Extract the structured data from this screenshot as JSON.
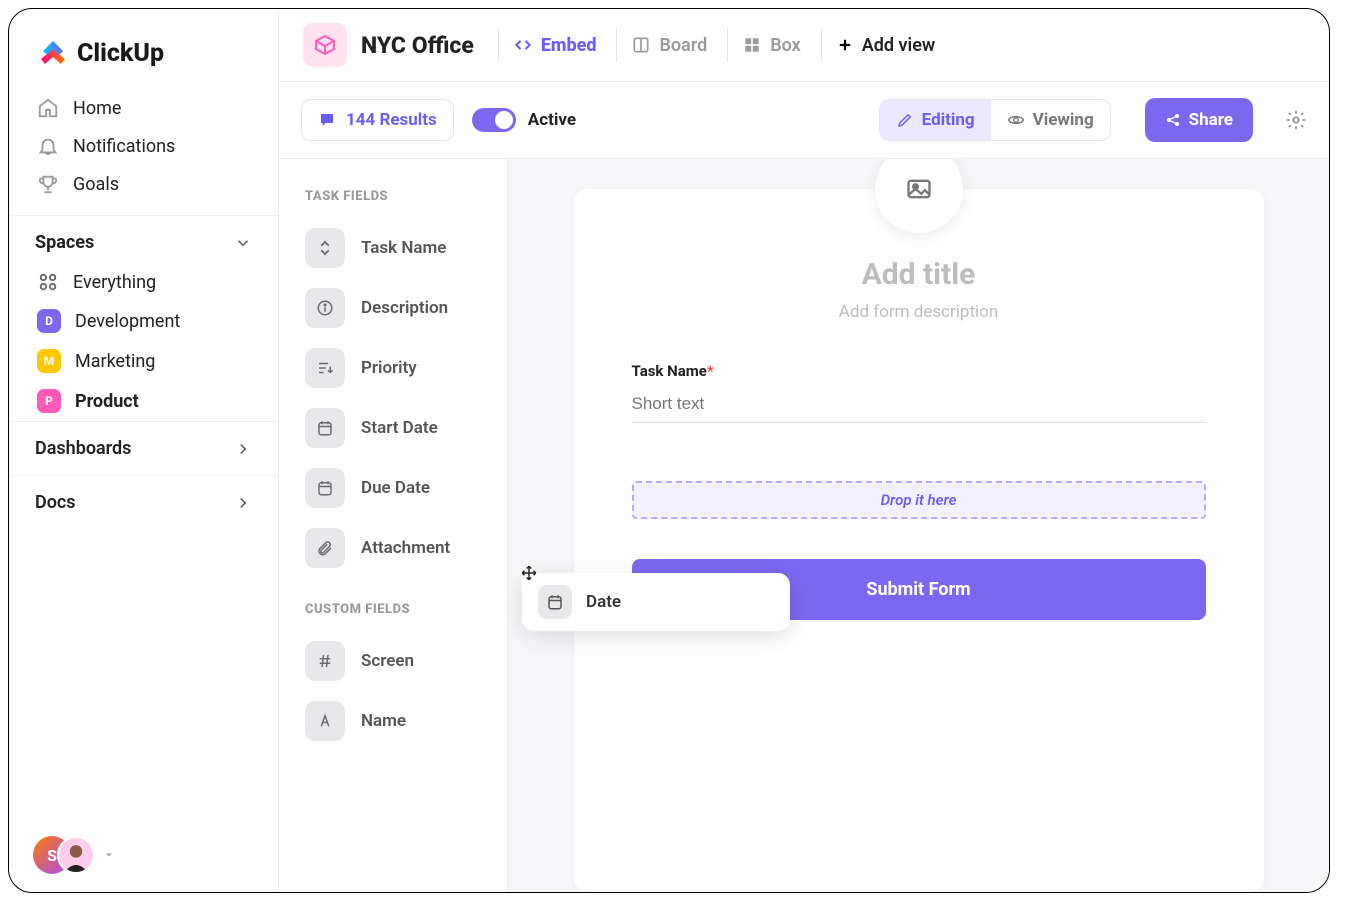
{
  "brand": {
    "name": "ClickUp"
  },
  "nav": {
    "home": "Home",
    "notifications": "Notifications",
    "goals": "Goals"
  },
  "spaces": {
    "header": "Spaces",
    "everything": "Everything",
    "items": [
      {
        "letter": "D",
        "label": "Development"
      },
      {
        "letter": "M",
        "label": "Marketing"
      },
      {
        "letter": "P",
        "label": "Product"
      }
    ]
  },
  "sections": {
    "dashboards": "Dashboards",
    "docs": "Docs"
  },
  "avatar": {
    "initial": "S"
  },
  "topbar": {
    "title": "NYC Office",
    "tabs": {
      "embed": "Embed",
      "board": "Board",
      "box": "Box",
      "addview": "Add view"
    }
  },
  "toolbar": {
    "results_count": "144 Results",
    "active_toggle": "Active",
    "editing": "Editing",
    "viewing": "Viewing",
    "share": "Share"
  },
  "fields_panel": {
    "task_header": "TASK FIELDS",
    "custom_header": "CUSTOM FIELDS",
    "task": {
      "task_name": "Task Name",
      "description": "Description",
      "priority": "Priority",
      "start_date": "Start Date",
      "due_date": "Due Date",
      "attachment": "Attachment"
    },
    "custom": {
      "screen": "Screen",
      "name": "Name"
    }
  },
  "form": {
    "title_placeholder": "Add title",
    "desc_placeholder": "Add form description",
    "field_label": "Task Name",
    "input_placeholder": "Short text",
    "drop_hint": "Drop it here",
    "submit": "Submit Form"
  },
  "drag_item": {
    "label": "Date"
  }
}
